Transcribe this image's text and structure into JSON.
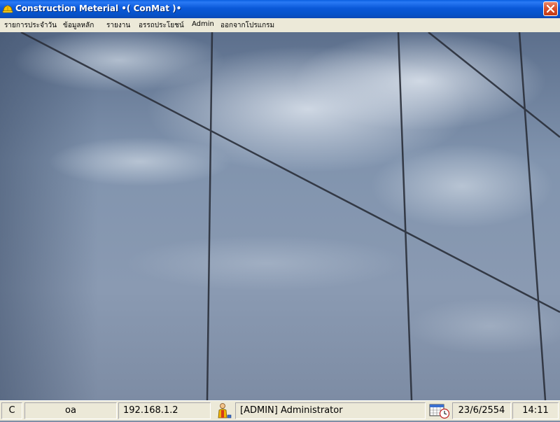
{
  "window": {
    "title": "Construction Meterial •( ConMat )•",
    "icon": "hard-hat-icon",
    "close_icon": "close-icon"
  },
  "menu": {
    "items": [
      {
        "label": "รายการประจำวัน"
      },
      {
        "label": "ข้อมูลหลัก"
      },
      {
        "label": "รายงาน"
      },
      {
        "label": "อรรถประโยชน์"
      },
      {
        "label": "Admin"
      },
      {
        "label": "ออกจากโปรแกรม"
      }
    ]
  },
  "statusbar": {
    "drive": "C",
    "database": "oa",
    "ip": "192.168.1.2",
    "user_icon": "user-icon",
    "user": "[ADMIN] Administrator",
    "calendar_icon": "calendar-clock-icon",
    "date": "23/6/2554",
    "time": "14:11"
  },
  "colors": {
    "titlebar": "#0a58d8",
    "menubar": "#ece9d8",
    "close_button": "#d9532f"
  }
}
